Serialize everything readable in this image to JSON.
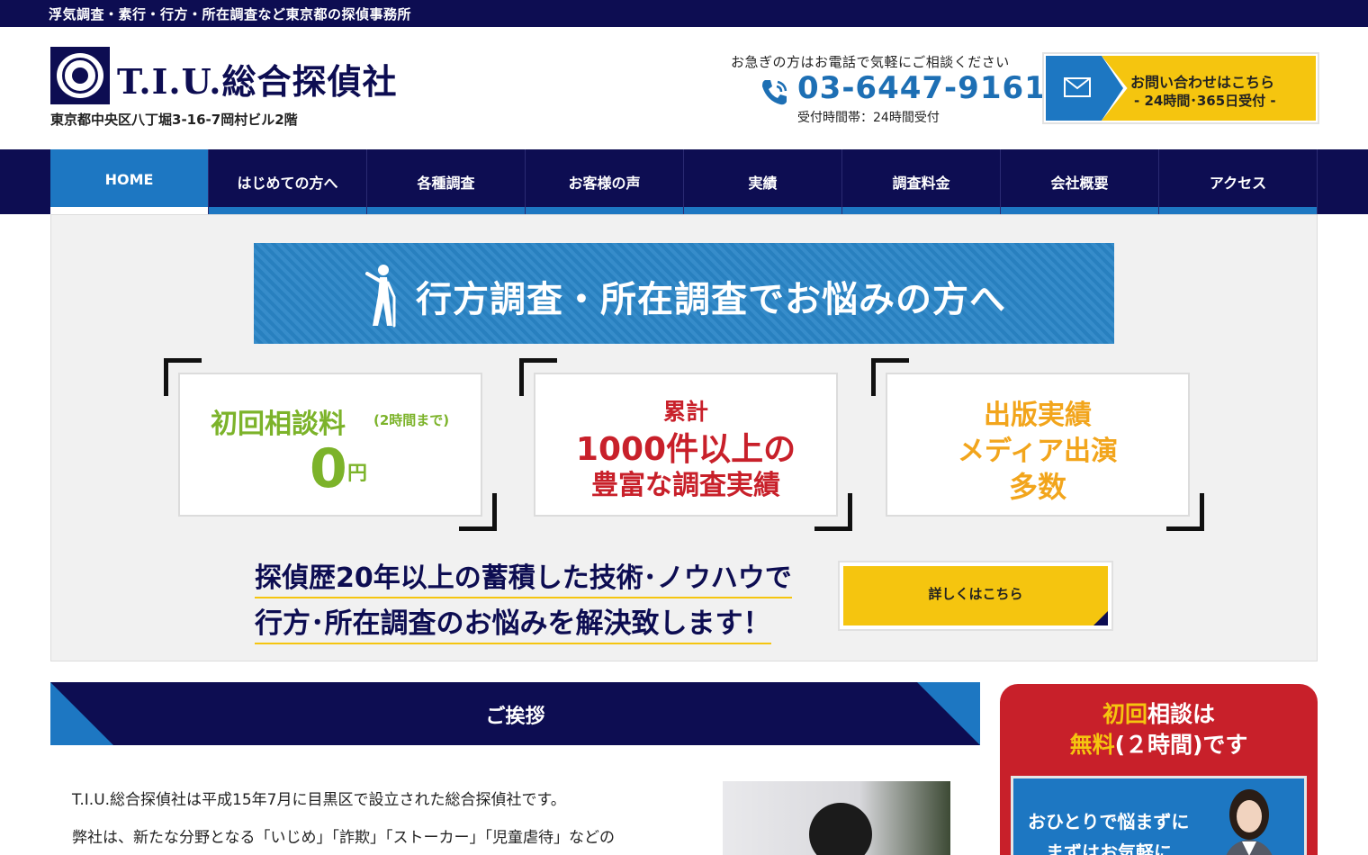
{
  "topbar": {
    "text": "浮気調査・素行・行方・所在調査など東京都の探偵事務所"
  },
  "header": {
    "logo_text": "T.I.U.総合探偵社",
    "address": "東京都中央区八丁堀3-16-7岡村ビル2階",
    "phone_lead": "お急ぎの方はお電話で気軽にご相談ください",
    "phone_number": "03-6447-9161",
    "phone_hours": "受付時間帯：24時間受付",
    "contact_line1": "お問い合わせはこちら",
    "contact_line2": "- 24時間･365日受付 -"
  },
  "nav": {
    "items": [
      {
        "label": "HOME"
      },
      {
        "label": "はじめての方へ"
      },
      {
        "label": "各種調査"
      },
      {
        "label": "お客様の声"
      },
      {
        "label": "実績"
      },
      {
        "label": "調査料金"
      },
      {
        "label": "会社概要"
      },
      {
        "label": "アクセス"
      }
    ]
  },
  "hero": {
    "banner_title": "行方調査・所在調査でお悩みの方へ",
    "card1": {
      "line1": "初回相談料",
      "line1_small": "(2時間まで)",
      "line2": "0",
      "line2_unit": "円"
    },
    "card2": {
      "line1": "累計",
      "line2": "1000件以上の",
      "line3": "豊富な調査実績"
    },
    "card3": {
      "line1": "出版実績",
      "line2": "メディア出演",
      "line3": "多数"
    },
    "tagline1": "探偵歴20年以上の蓄積した技術･ノウハウで",
    "tagline2": "行方･所在調査のお悩みを解決致します！",
    "detail_button": "詳しくはこちら"
  },
  "greeting": {
    "title": "ご挨拶",
    "para1": "T.I.U.総合探偵社は平成15年7月に目黒区で設立された総合探偵社です。",
    "para2": "弊社は、新たな分野となる「いじめ」「詐欺」「ストーカー」「児童虐待」などの"
  },
  "sidebar": {
    "headline1_accent": "初回",
    "headline1_rest": "相談は",
    "headline2_accent": "無料",
    "headline2_rest": "(２時間)です",
    "inner_line1": "おひとりで悩まずに",
    "inner_line2": "まずはお気軽に"
  },
  "colors": {
    "navy": "#0d0d52",
    "blue": "#1d77c2",
    "yellow": "#f5c50f",
    "green": "#7cb32a",
    "red": "#c8202a",
    "orange": "#f2a51c"
  },
  "icons": [
    "logo-emblem-icon",
    "phone-icon",
    "mail-icon",
    "elderly-person-icon"
  ]
}
